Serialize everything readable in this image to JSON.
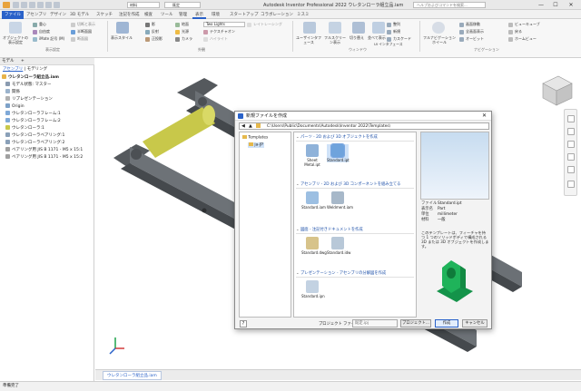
{
  "window": {
    "title": "Autodesk Inventor Professional 2022   ウレタンローラ組立品.iam",
    "search_placeholder": "ヘルプおよびコマンドを検索...",
    "minimize": "—",
    "maximize": "☐",
    "close": "✕"
  },
  "quick_access": {
    "material_select": "材料",
    "appearance_select": "既定"
  },
  "ribbon_tabs": [
    "ファイル",
    "アセンブリ",
    "デザイン",
    "3D モデル",
    "スケッチ",
    "注記を作成",
    "検査",
    "ツール",
    "管理",
    "表示",
    "環境",
    "スタートアップ",
    "コラボレーション",
    "ミスミ"
  ],
  "active_tab": "表示",
  "ribbon": {
    "visibility": {
      "big_button": "オブジェクトの表示設定",
      "items": [
        "重心",
        "自由度",
        "iMate 記号 (M)",
        "切断と表示",
        "半断面図",
        "断面図"
      ],
      "group_label": "表示設定"
    },
    "appearance": {
      "big_button": "表示スタイル",
      "items": [
        "影",
        "反射",
        "正投影",
        "地面",
        "光源",
        "カメラ"
      ],
      "lighting_select": "Two Lights",
      "extra": [
        "テクスチャオン",
        "ハイライト",
        "レイトレーシング"
      ],
      "group_label": "外観"
    },
    "windows": {
      "buttons": [
        "ユーザインタフェース",
        "フルスクリーン表示",
        "切り替え",
        "並べて表示"
      ],
      "items": [
        "整列",
        "新規",
        "カスケード",
        "UI インタフェース"
      ],
      "group_label": "ウィンドウ"
    },
    "navigation": {
      "buttons": [
        "フルナビゲーションホイール"
      ],
      "items": [
        "画面移動",
        "全画面表示",
        "オービット",
        "ビューキューブ",
        "戻る",
        "ホームビュー"
      ],
      "group_label": "ナビゲーション"
    }
  },
  "model_panel": {
    "header": "モデル",
    "add_label": "+",
    "subtabs": [
      "アセンブリ",
      "モデリング"
    ],
    "tree": [
      {
        "label": "ウレタンローラ組立品.iam",
        "level": 0,
        "bold": true
      },
      {
        "label": "モデル状態: マスター",
        "level": 1
      },
      {
        "label": "関係",
        "level": 1
      },
      {
        "label": "リプレゼンテーション",
        "level": 1
      },
      {
        "label": "Origin",
        "level": 1
      },
      {
        "label": "ウレタンローラフレーム:1",
        "level": 1
      },
      {
        "label": "ウレタンローラフレーム:2",
        "level": 1
      },
      {
        "label": "ウレタンローラ:1",
        "level": 1
      },
      {
        "label": "ウレタンローラベアリング:1",
        "level": 1
      },
      {
        "label": "ウレタンローラベアリング:2",
        "level": 1
      },
      {
        "label": "ベアリング用 JIS B 1171 - M5 x 15:1",
        "level": 1
      },
      {
        "label": "ベアリング用 JIS B 1171 - M5 x 15:2",
        "level": 1
      }
    ]
  },
  "document_tab": "ウレタンローラ組立品.iam",
  "status_text": "準備完了",
  "dialog": {
    "title": "新規ファイルを作成",
    "path": "C:\\Users\\Public\\Documents\\Autodesk\\Inventor 2022\\Templates\\",
    "tree": [
      {
        "label": "Templates",
        "level": 0
      },
      {
        "label": "ja-JP",
        "level": 1
      }
    ],
    "sections": [
      {
        "title": "パーツ - 2D および 3D オブジェクトを作成",
        "templates": [
          "Sheet Metal.ipt",
          "Standard.ipt"
        ]
      },
      {
        "title": "アセンブリ - 2D および 3D コンポーネントを組み立てる",
        "templates": [
          "Standard.iam",
          "Weldment.iam"
        ]
      },
      {
        "title": "図面 - 注記付きドキュメントを作成",
        "templates": [
          "Standard.dwg",
          "Standard.idw"
        ]
      },
      {
        "title": "プレゼンテーション - アセンブリの分解図を作成",
        "templates": [
          "Standard.ipn"
        ]
      }
    ],
    "selected_template": "Standard.ipt",
    "info": [
      {
        "key": "ファイル",
        "value": "Standard.ipt"
      },
      {
        "key": "表示名",
        "value": "Part"
      },
      {
        "key": "単位",
        "value": "millimeter"
      },
      {
        "key": "材料",
        "value": "一般"
      }
    ],
    "description": "このテンプレートは、フィーチャを持つ 1 つのソリッドボディで構成される 3D または 3D オブジェクトを作成します。",
    "project_label": "プロジェクト ファイル:",
    "project_value": "既定.ipj",
    "project_button": "プロジェクト...",
    "create_button": "作成",
    "cancel_button": "キャンセル"
  },
  "colors": {
    "accent": "#2a62c9",
    "roller": "#c8c84a",
    "frame": "#5b5f63",
    "preview_part": "#1fb35a"
  }
}
